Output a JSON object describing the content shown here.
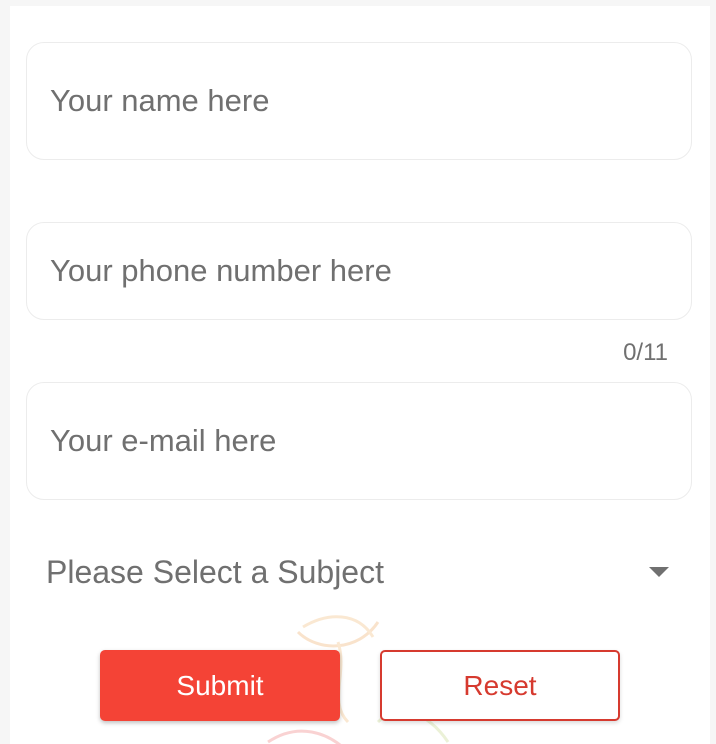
{
  "form": {
    "name_field": {
      "placeholder": "Your name here",
      "value": ""
    },
    "phone_field": {
      "placeholder": "Your phone number here",
      "value": "",
      "counter": "0/11"
    },
    "email_field": {
      "placeholder": "Your e-mail here",
      "value": ""
    },
    "subject_select": {
      "selected": "Please Select a Subject",
      "icon": "caret-down-icon"
    },
    "buttons": {
      "submit_label": "Submit",
      "reset_label": "Reset"
    }
  },
  "colors": {
    "accent": "#f44336",
    "reset_outline": "#d63a2f",
    "placeholder_text": "#707070",
    "field_border": "#ececec"
  }
}
